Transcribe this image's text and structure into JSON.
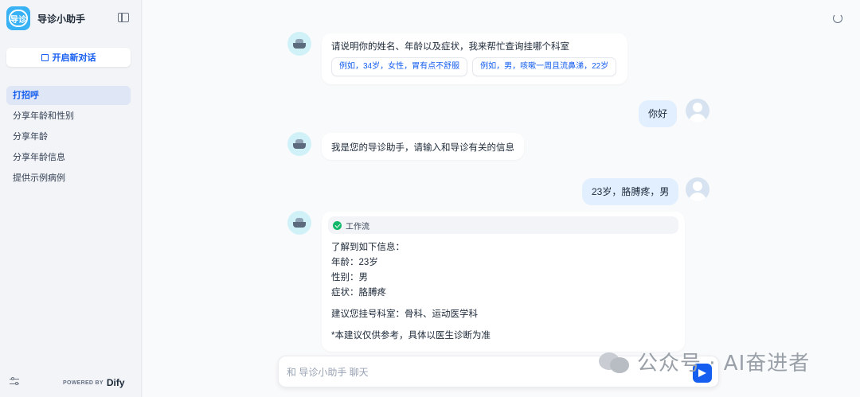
{
  "app": {
    "title": "导诊小助手",
    "logo_text": "导诊"
  },
  "sidebar": {
    "new_chat_label": "开启新对话",
    "items": [
      {
        "label": "打招呼",
        "active": true
      },
      {
        "label": "分享年龄和性别",
        "active": false
      },
      {
        "label": "分享年龄",
        "active": false
      },
      {
        "label": "分享年龄信息",
        "active": false
      },
      {
        "label": "提供示例病例",
        "active": false
      }
    ],
    "powered_by": "POWERED BY",
    "brand": "Dify"
  },
  "chat": {
    "messages": [
      {
        "role": "bot",
        "text": "请说明你的姓名、年龄以及症状，我来帮忙查询挂哪个科室",
        "suggestions": [
          "例如，34岁，女性，胃有点不舒服",
          "例如，男，咳嗽一周且流鼻涕，22岁"
        ]
      },
      {
        "role": "user",
        "text": "你好"
      },
      {
        "role": "bot",
        "text": "我是您的导诊助手，请输入和导诊有关的信息"
      },
      {
        "role": "user",
        "text": "23岁，胳膊疼，男"
      },
      {
        "role": "bot",
        "workflow_label": "工作流",
        "lines": [
          "了解到如下信息：",
          "年龄：23岁",
          "性别：男",
          "症状：胳膊疼"
        ],
        "suggestion": "建议您挂号科室：骨科、运动医学科",
        "disclaimer": "*本建议仅供参考，具体以医生诊断为准"
      }
    ]
  },
  "input": {
    "placeholder": "和 导诊小助手 聊天"
  },
  "watermark": {
    "text": "公众号 · AI奋进者"
  },
  "colors": {
    "accent": "#155eef",
    "user_bubble": "#e1effe",
    "success": "#12b76a"
  }
}
